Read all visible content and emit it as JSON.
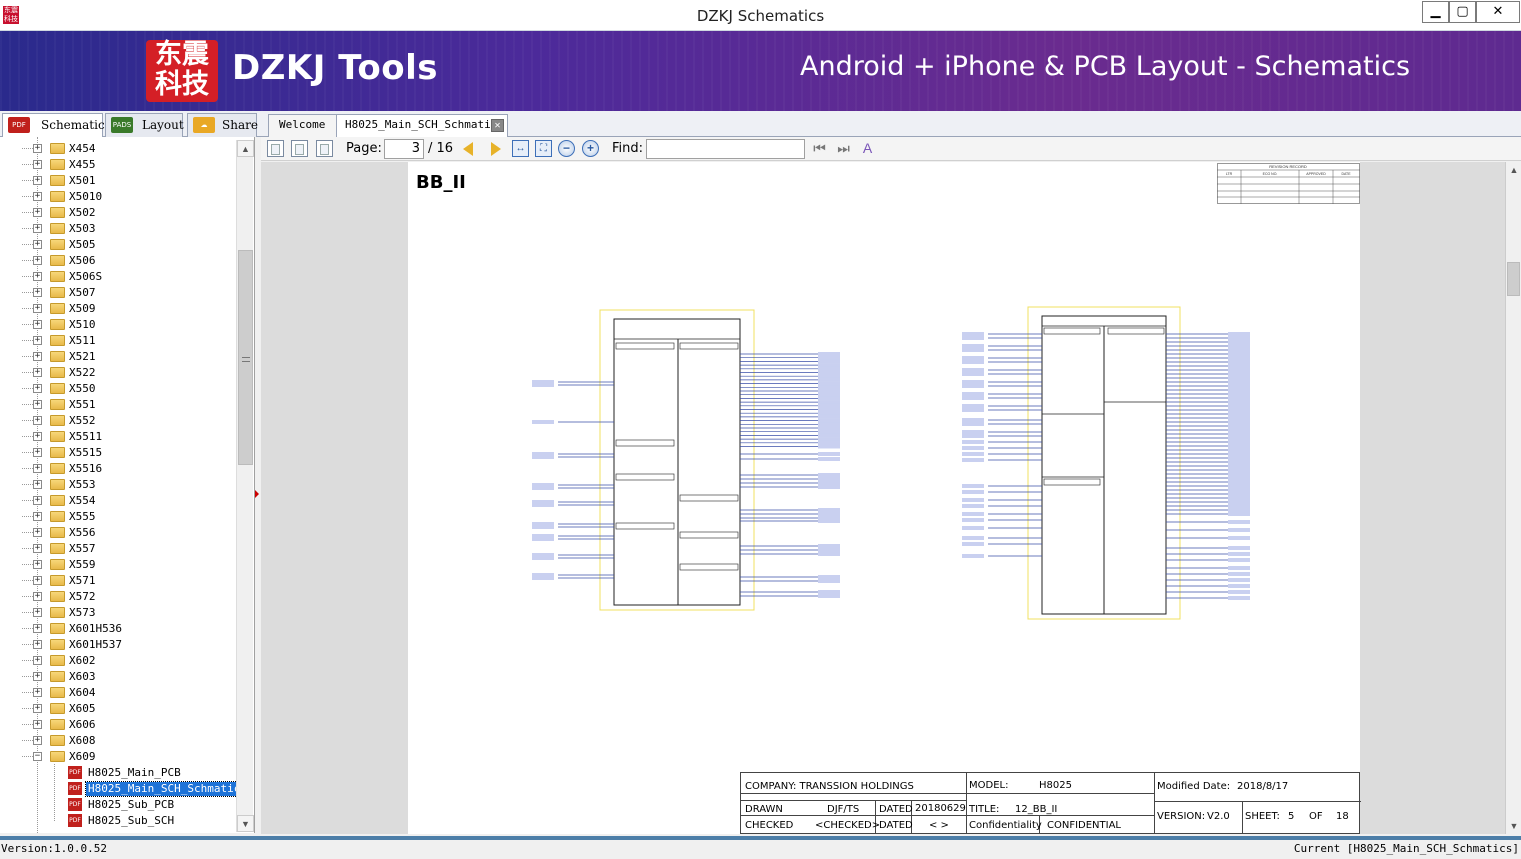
{
  "window": {
    "title": "DZKJ Schematics",
    "icon_text": "东震科技"
  },
  "banner": {
    "logo_text": "东震科技",
    "title": "DZKJ Tools",
    "tagline": "Android + iPhone & PCB Layout - Schematics"
  },
  "left_tabs": [
    {
      "label": "Schematic",
      "icon": "PDF"
    },
    {
      "label": "Layout",
      "icon": "PADS"
    },
    {
      "label": "Share",
      "icon": "share-icon"
    }
  ],
  "doc_tabs": [
    {
      "label": "Welcome"
    },
    {
      "label": "H8025_Main_SCH_Schmatics",
      "close": "✕"
    }
  ],
  "tree": {
    "folders": [
      "X454",
      "X455",
      "X501",
      "X5010",
      "X502",
      "X503",
      "X505",
      "X506",
      "X506S",
      "X507",
      "X509",
      "X510",
      "X511",
      "X521",
      "X522",
      "X550",
      "X551",
      "X552",
      "X5511",
      "X5515",
      "X5516",
      "X553",
      "X554",
      "X555",
      "X556",
      "X557",
      "X559",
      "X571",
      "X572",
      "X573",
      "X601H536",
      "X601H537",
      "X602",
      "X603",
      "X604",
      "X605",
      "X606",
      "X608",
      "X609"
    ],
    "files": [
      "H8025_Main_PCB",
      "H8025_Main_SCH_Schmatics",
      "H8025_Sub_PCB",
      "H8025_Sub_SCH"
    ],
    "selected_file": "H8025_Main_SCH_Schmatics"
  },
  "toolbar": {
    "page_label": "Page:",
    "page_value": "3",
    "page_total": "/ 16",
    "find_label": "Find:",
    "find_value": ""
  },
  "page": {
    "heading": "BB_II",
    "revision_title": "REVISION RECORD",
    "revision_columns": [
      "LTR",
      "ECO NO.",
      "APPROVED",
      "DATE"
    ]
  },
  "title_block": {
    "company": "COMPANY: TRANSSION HOLDINGS",
    "model_label": "MODEL:",
    "model_value": "H8025",
    "modified_label": "Modified Date:",
    "modified_value": "2018/8/17",
    "drawn_label": "DRAWN",
    "drawn_value": "DJF/TS",
    "dated_label": "DATED",
    "dated_value": "20180629",
    "title_label": "TITLE:",
    "title_value": "12_BB_II",
    "checked_label": "CHECKED",
    "checked_value": "<CHECKED>",
    "dated2_label": "DATED",
    "dated2_value": "< >",
    "confidentiality_label": "Confidentiality",
    "confidentiality_value": "CONFIDENTIAL",
    "version_label": "VERSION:",
    "version_value": "V2.0",
    "sheet_label": "SHEET:",
    "sheet_value": "5",
    "of_label": "OF",
    "of_value": "18"
  },
  "status": {
    "version": "Version:1.0.0.52",
    "current": "Current [H8025_Main_SCH_Schmatics]"
  },
  "colors": {
    "banner_start": "#2a2a8c",
    "banner_end": "#6a2b8f",
    "status_band": "#4c7ea8",
    "selection": "#1e73d8"
  }
}
